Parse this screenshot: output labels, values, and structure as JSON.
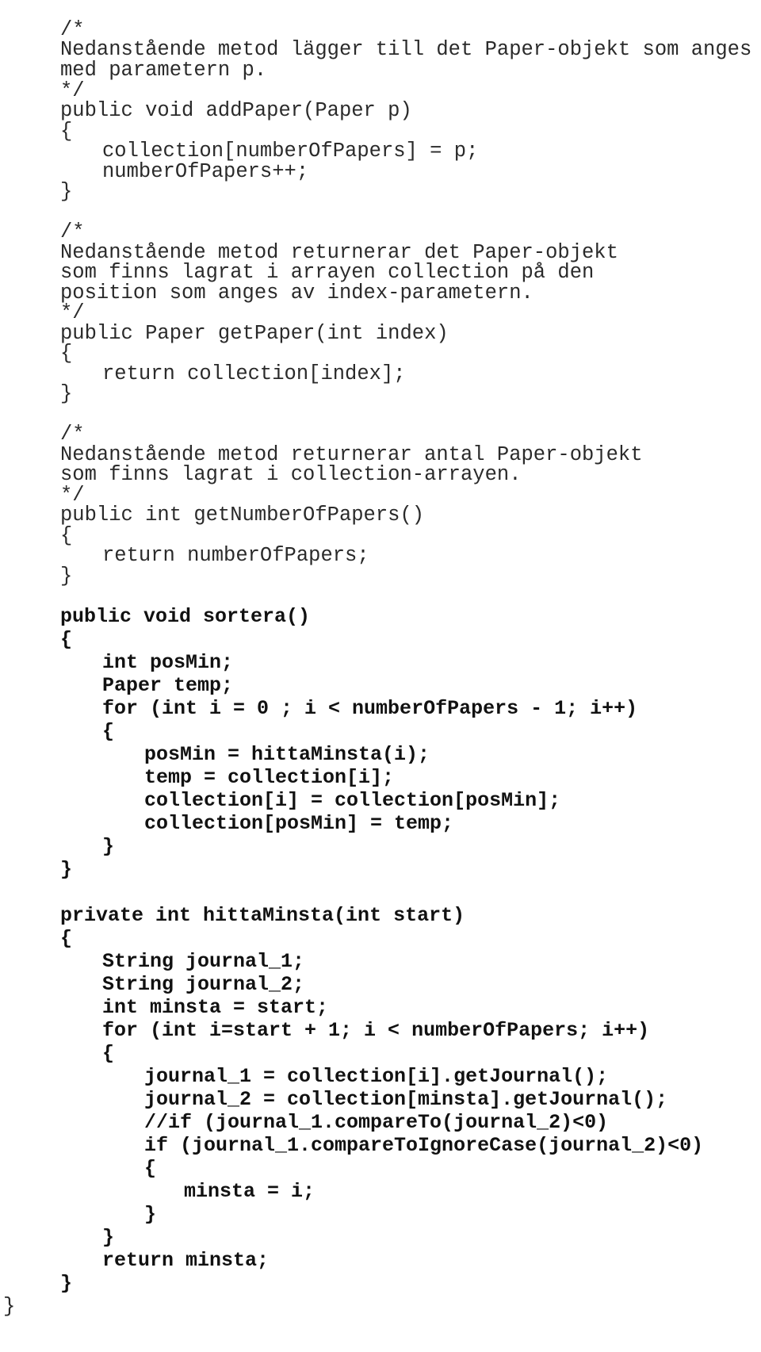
{
  "document": {
    "language": "Java",
    "lines": [
      {
        "text": "/*",
        "indent": 1,
        "bold": false
      },
      {
        "text": "Nedanstående metod lägger till det Paper-objekt som anges",
        "indent": 1,
        "bold": false
      },
      {
        "text": "med parametern p.",
        "indent": 1,
        "bold": false
      },
      {
        "text": "*/",
        "indent": 1,
        "bold": false
      },
      {
        "text": "public void addPaper(Paper p)",
        "indent": 1,
        "bold": false
      },
      {
        "text": "{",
        "indent": 1,
        "bold": false
      },
      {
        "text": "collection[numberOfPapers] = p;",
        "indent": 2,
        "bold": false
      },
      {
        "text": "numberOfPapers++;",
        "indent": 2,
        "bold": false
      },
      {
        "text": "}",
        "indent": 1,
        "bold": false
      },
      {
        "text": "",
        "indent": 1,
        "bold": false
      },
      {
        "text": "/*",
        "indent": 1,
        "bold": false
      },
      {
        "text": "Nedanstående metod returnerar det Paper-objekt",
        "indent": 1,
        "bold": false
      },
      {
        "text": "som finns lagrat i arrayen collection på den",
        "indent": 1,
        "bold": false
      },
      {
        "text": "position som anges av index-parametern.",
        "indent": 1,
        "bold": false
      },
      {
        "text": "*/",
        "indent": 1,
        "bold": false
      },
      {
        "text": "public Paper getPaper(int index)",
        "indent": 1,
        "bold": false
      },
      {
        "text": "{",
        "indent": 1,
        "bold": false
      },
      {
        "text": "return collection[index];",
        "indent": 2,
        "bold": false
      },
      {
        "text": "}",
        "indent": 1,
        "bold": false
      },
      {
        "text": "",
        "indent": 1,
        "bold": false
      },
      {
        "text": "/*",
        "indent": 1,
        "bold": false
      },
      {
        "text": "Nedanstående metod returnerar antal Paper-objekt",
        "indent": 1,
        "bold": false
      },
      {
        "text": "som finns lagrat i collection-arrayen.",
        "indent": 1,
        "bold": false
      },
      {
        "text": "*/",
        "indent": 1,
        "bold": false
      },
      {
        "text": "public int getNumberOfPapers()",
        "indent": 1,
        "bold": false
      },
      {
        "text": "{",
        "indent": 1,
        "bold": false
      },
      {
        "text": "return numberOfPapers;",
        "indent": 2,
        "bold": false
      },
      {
        "text": "}",
        "indent": 1,
        "bold": false
      },
      {
        "text": "",
        "indent": 1,
        "bold": false
      },
      {
        "text": "public void sortera()",
        "indent": 1,
        "bold": true
      },
      {
        "text": "{",
        "indent": 1,
        "bold": true
      },
      {
        "text": "int posMin;",
        "indent": 2,
        "bold": true
      },
      {
        "text": "Paper temp;",
        "indent": 2,
        "bold": true
      },
      {
        "text": "for (int i = 0 ; i < numberOfPapers - 1; i++)",
        "indent": 2,
        "bold": true
      },
      {
        "text": "{",
        "indent": 2,
        "bold": true
      },
      {
        "text": "posMin = hittaMinsta(i);",
        "indent": 3,
        "bold": true
      },
      {
        "text": "temp = collection[i];",
        "indent": 3,
        "bold": true
      },
      {
        "text": "collection[i] = collection[posMin];",
        "indent": 3,
        "bold": true
      },
      {
        "text": "collection[posMin] = temp;",
        "indent": 3,
        "bold": true
      },
      {
        "text": "}",
        "indent": 2,
        "bold": true
      },
      {
        "text": "}",
        "indent": 1,
        "bold": true
      },
      {
        "text": "",
        "indent": 1,
        "bold": true
      },
      {
        "text": "private int hittaMinsta(int start)",
        "indent": 1,
        "bold": true
      },
      {
        "text": "{",
        "indent": 1,
        "bold": true
      },
      {
        "text": "String journal_1;",
        "indent": 2,
        "bold": true
      },
      {
        "text": "String journal_2;",
        "indent": 2,
        "bold": true
      },
      {
        "text": "int minsta = start;",
        "indent": 2,
        "bold": true
      },
      {
        "text": "for (int i=start + 1; i < numberOfPapers; i++)",
        "indent": 2,
        "bold": true
      },
      {
        "text": "{",
        "indent": 2,
        "bold": true
      },
      {
        "text": "journal_1 = collection[i].getJournal();",
        "indent": 3,
        "bold": true
      },
      {
        "text": "journal_2 = collection[minsta].getJournal();",
        "indent": 3,
        "bold": true
      },
      {
        "text": "//if (journal_1.compareTo(journal_2)<0)",
        "indent": 3,
        "bold": true
      },
      {
        "text": "if (journal_1.compareToIgnoreCase(journal_2)<0)",
        "indent": 3,
        "bold": true
      },
      {
        "text": "{",
        "indent": 3,
        "bold": true
      },
      {
        "text": "minsta = i;",
        "indent": 4,
        "bold": true
      },
      {
        "text": "}",
        "indent": 3,
        "bold": true
      },
      {
        "text": "}",
        "indent": 2,
        "bold": true
      },
      {
        "text": "return minsta;",
        "indent": 2,
        "bold": true
      },
      {
        "text": "}",
        "indent": 1,
        "bold": true
      },
      {
        "text": "}",
        "indent": 0,
        "bold": false
      }
    ]
  }
}
